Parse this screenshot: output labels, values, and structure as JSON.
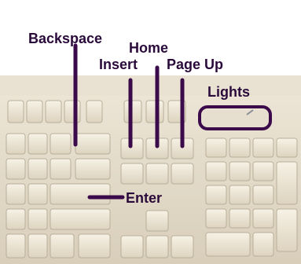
{
  "labels": {
    "backspace": "Backspace",
    "home": "Home",
    "insert": "Insert",
    "page_up": "Page Up",
    "lights": "Lights",
    "enter": "Enter"
  },
  "colors": {
    "label_text": "#2a0a3a",
    "pointer_line": "#3b0a4a",
    "keyboard_body": "#e4dccb",
    "key_face": "#f1ebdc",
    "key_shadow": "#b9ae98",
    "background": "#ffffff"
  }
}
